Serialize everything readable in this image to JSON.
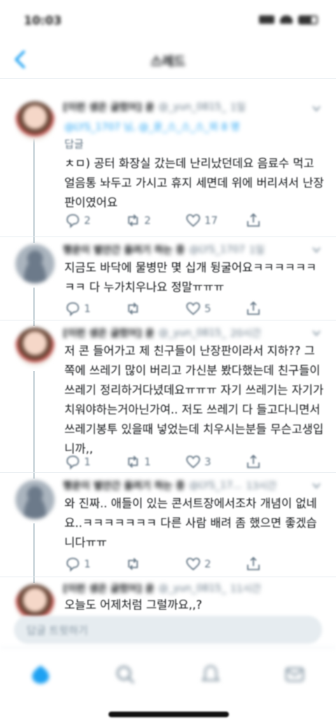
{
  "status_bar": {
    "time": "10:03"
  },
  "nav": {
    "title": "스레드"
  },
  "tweets": [
    {
      "name": "[이런 생은 글렀어] 윤",
      "handle": "@_yun_0815_",
      "time": "1일",
      "reply_to": "@LYS_1707 님, @_윤_스_스_스_외 8 명",
      "reply_label": "답글",
      "text": "ㅊㅁ) 공터 화장실 갔는데 난리났던데요 음료수 먹고 얼음통 놔두고 가시고 휴지 세면데 위에 버리셔서 난장판이였어요",
      "replies": "2",
      "retweets": "2",
      "likes": "17"
    },
    {
      "name": "행운이 별안간 올려기 하는 중",
      "handle": "@LYS_1707",
      "time": "1일",
      "text": "지금도 바닥에 물병만 몇 십개 뒹굴어요ㅋㅋㅋㅋㅋㅋㅋㅋ 다 누가치우나요 정말ㅠㅠㅠ",
      "replies": "1",
      "retweets": "",
      "likes": "5"
    },
    {
      "name": "[이런 생은 글렀어] 윤",
      "handle": "@_yun_0815_",
      "time": "20시간",
      "text": "저 콘 들어가고 제 친구들이 난장판이라서 지하?? 그쪽에 쓰레기 많이 버리고 가신분 봤다했는데 친구들이 쓰레기 정리하거다녔데요ㅠㅠㅠ 자기 쓰레기는 자기가 치워야하는거아닌가여.. 저도 쓰레기 다 들고다니면서 쓰레기봉투 있을때 넣었는데 치우시는분들 무슨고생입니까,,",
      "replies": "1",
      "retweets": "1",
      "likes": "3"
    },
    {
      "name": "행운이 별안간 올려기 하는 중",
      "handle": "@LYS_17...",
      "time": "13시간",
      "text": "와 진짜.. 애들이 있는 콘서트장에서조차 개념이 없네요..ㅋㅋㅋㅋㅋㅋㅋ 다른 사람 배려 좀 했으면 좋겠습니다ㅠㅠ",
      "replies": "1",
      "retweets": "",
      "likes": "2"
    },
    {
      "name": "[이런 생은 글렀어] 윤",
      "handle": "@_yun_0815_",
      "time": "11시간",
      "text": "오늘도 어제처럼 그럴까요,,?"
    }
  ],
  "compose": {
    "placeholder": "답글 트윗하기"
  },
  "colors": {
    "accent": "#1da1f2",
    "muted": "#657786",
    "text": "#14171a",
    "divider": "#e6ecf0"
  }
}
